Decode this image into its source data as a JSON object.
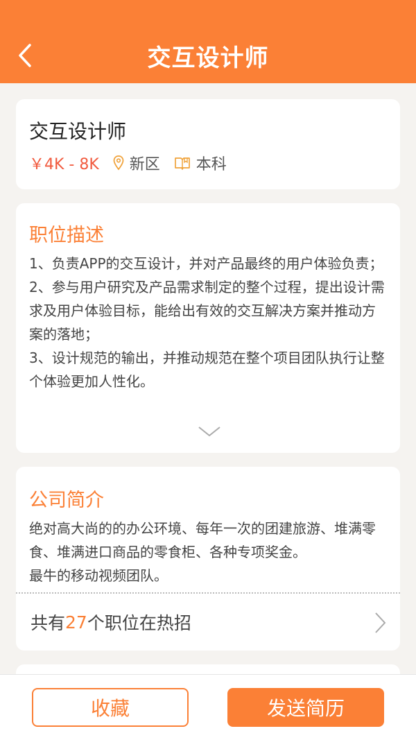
{
  "header": {
    "title": "交互设计师",
    "back_icon": "chevron-left-icon"
  },
  "job": {
    "title": "交互设计师",
    "salary": "￥4K - 8K",
    "location": "新区",
    "education": "本科"
  },
  "description": {
    "title": "职位描述",
    "lines": [
      "1、负责APP的交互设计，并对产品最终的用户体验负责；",
      "2、参与用户研究及产品需求制定的整个过程，提出设计需求及用户体验目标，能给出有效的交互解决方案并推动方案的落地；",
      "3、设计规范的输出，并推动规范在整个项目团队执行让整个体验更加人性化。"
    ]
  },
  "company": {
    "title": "公司简介",
    "intro_lines": [
      "绝对高大尚的的办公环境、每年一次的团建旅游、堆满零食、堆满进口商品的零食柜、各种专项奖金。",
      "最牛的移动视频团队。"
    ],
    "jobs_prefix": "共有",
    "jobs_count": "27",
    "jobs_suffix": "个职位在热招"
  },
  "actions": {
    "favorite_label": "收藏",
    "send_resume_label": "发送简历"
  },
  "colors": {
    "accent": "#fb8036",
    "salary": "#f15a3e",
    "background": "#f5f3f0"
  }
}
